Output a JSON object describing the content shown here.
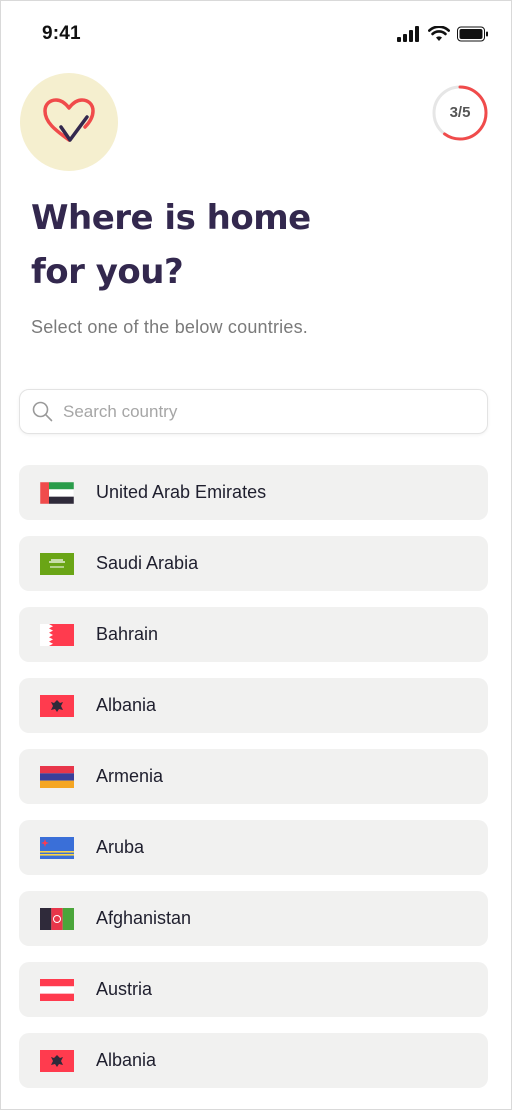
{
  "status_bar": {
    "time": "9:41"
  },
  "progress": {
    "label": "3/5",
    "current": 3,
    "total": 5,
    "accent": "#f04b4b"
  },
  "logo": {
    "icon": "heart-check-icon",
    "bg": "#f5efcf"
  },
  "heading": {
    "line1": "Where is home",
    "line2": "for you?"
  },
  "subtitle": "Select one of the below countries.",
  "search": {
    "placeholder": "Search country",
    "value": ""
  },
  "countries": [
    {
      "name": "United Arab Emirates",
      "flag": "uae-flag-icon"
    },
    {
      "name": "Saudi Arabia",
      "flag": "saudi-arabia-flag-icon"
    },
    {
      "name": "Bahrain",
      "flag": "bahrain-flag-icon"
    },
    {
      "name": "Albania",
      "flag": "albania-flag-icon"
    },
    {
      "name": "Armenia",
      "flag": "armenia-flag-icon"
    },
    {
      "name": "Aruba",
      "flag": "aruba-flag-icon"
    },
    {
      "name": "Afghanistan",
      "flag": "afghanistan-flag-icon"
    },
    {
      "name": "Austria",
      "flag": "austria-flag-icon"
    },
    {
      "name": "Albania",
      "flag": "albania-flag-icon"
    }
  ]
}
